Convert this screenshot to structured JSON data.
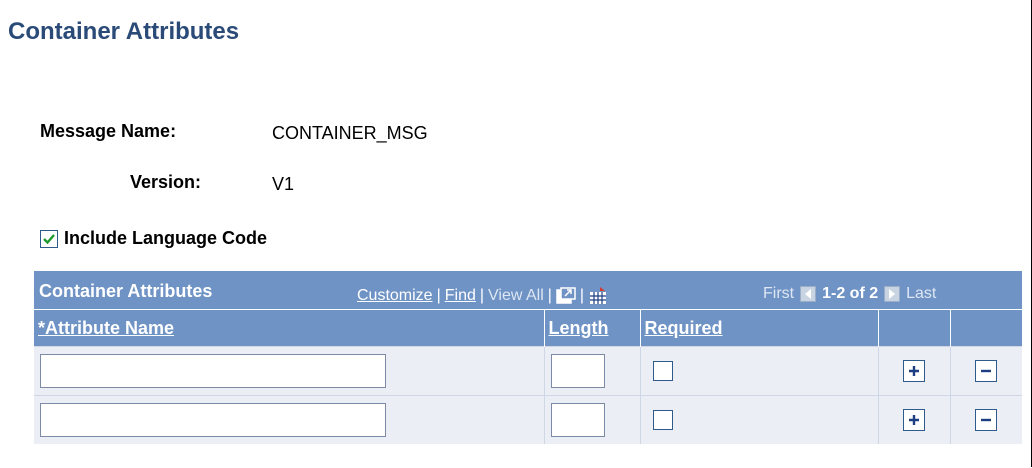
{
  "page": {
    "title": "Container Attributes"
  },
  "fields": {
    "message_name_label": "Message Name:",
    "message_name_value": "CONTAINER_MSG",
    "version_label": "Version:",
    "version_value": "V1",
    "include_language_label": "Include Language Code",
    "include_language_checked": true
  },
  "grid": {
    "title": "Container Attributes",
    "tools": {
      "customize": "Customize",
      "find": "Find",
      "view_all": "View All",
      "sep": "|"
    },
    "nav": {
      "first": "First",
      "range": "1-2 of 2",
      "last": "Last"
    },
    "columns": {
      "attribute_name": "*Attribute Name",
      "length": "Length",
      "required": "Required"
    },
    "rows": [
      {
        "attribute_name": "",
        "length": "",
        "required": false
      },
      {
        "attribute_name": "",
        "length": "",
        "required": false
      }
    ]
  },
  "icons": [
    "check-icon",
    "new-window-icon",
    "grid-download-icon",
    "nav-left-arrow-icon",
    "nav-right-arrow-icon",
    "add-row-icon",
    "delete-row-icon"
  ],
  "colors": {
    "title": "#2a4a78",
    "grid_header": "#6f93c5",
    "row_bg": "#eceef5"
  }
}
